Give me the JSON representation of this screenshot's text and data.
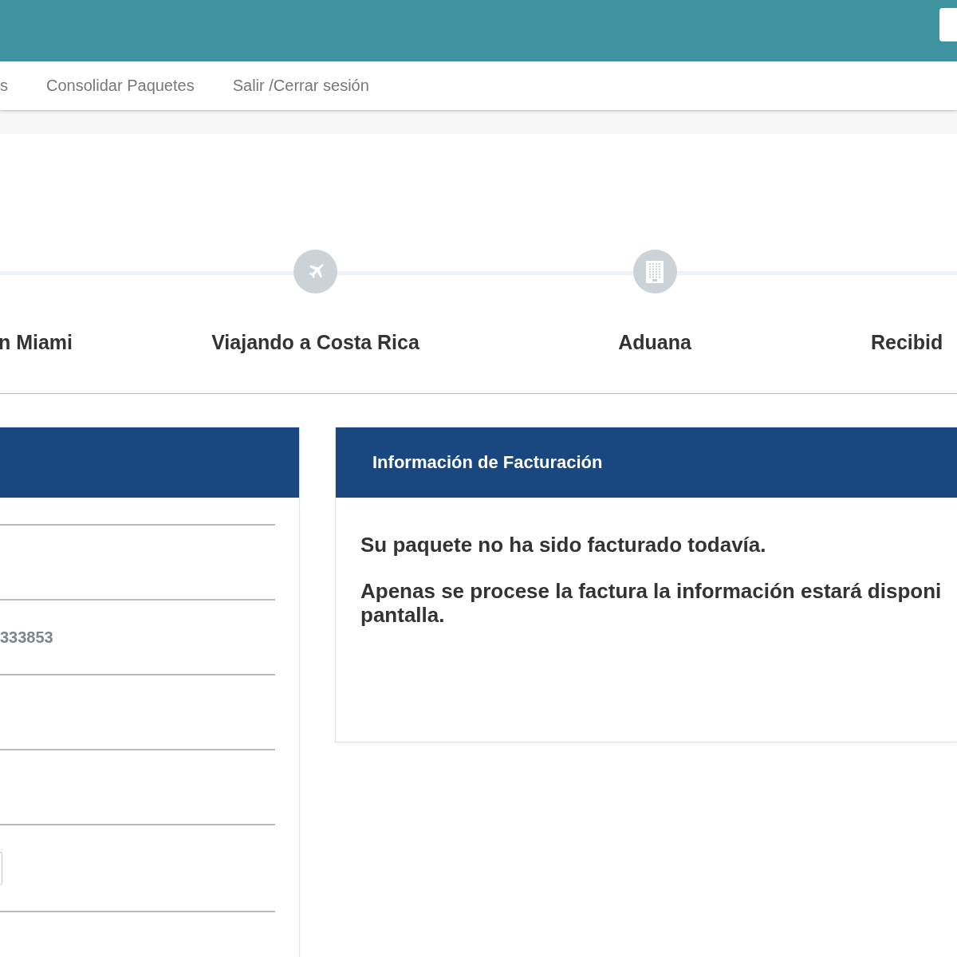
{
  "nav": {
    "items": [
      {
        "label": "s"
      },
      {
        "label": "Consolidar Paquetes"
      },
      {
        "label": "Salir /Cerrar sesión"
      }
    ]
  },
  "tracking": {
    "steps": [
      {
        "label": "n Miami"
      },
      {
        "label": "Viajando a Costa Rica",
        "kind": "plane"
      },
      {
        "label": "Aduana",
        "kind": "building"
      },
      {
        "label": "Recibid"
      }
    ]
  },
  "package_panel": {
    "rows": [
      {
        "kind": "blank"
      },
      {
        "kind": "value",
        "value": "333853"
      },
      {
        "kind": "blank"
      },
      {
        "kind": "blank"
      },
      {
        "kind": "button"
      }
    ]
  },
  "billing_panel": {
    "title": "Información de Facturación",
    "message": "Su paquete no ha sido facturado todavía.",
    "note_lines": [
      "Apenas se procese la factura la información estará disponi",
      "pantalla."
    ]
  }
}
